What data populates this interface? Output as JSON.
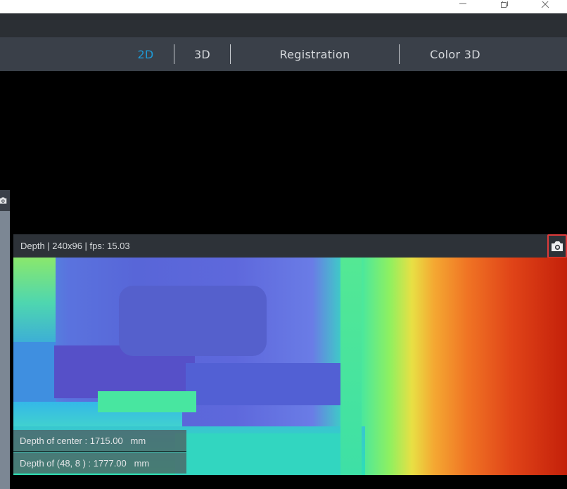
{
  "window": {
    "minimize_icon": "minimize-icon",
    "restore_icon": "restore-icon",
    "close_icon": "close-icon"
  },
  "tabs": [
    {
      "label": "2D",
      "active": true
    },
    {
      "label": "3D",
      "active": false
    },
    {
      "label": "Registration",
      "active": false
    },
    {
      "label": "Color 3D",
      "active": false
    }
  ],
  "depth_panel": {
    "title": "Depth | 240x96 | fps: 15.03",
    "snapshot_icon": "camera-icon",
    "center_label": "Depth of center : 1715.00   mm",
    "point_label": "Depth of (48, 8 ) : 1777.00   mm"
  },
  "colors": {
    "accent": "#1e9ad6",
    "highlight_border": "#e03a3a",
    "tab_bar": "#3a4049"
  }
}
